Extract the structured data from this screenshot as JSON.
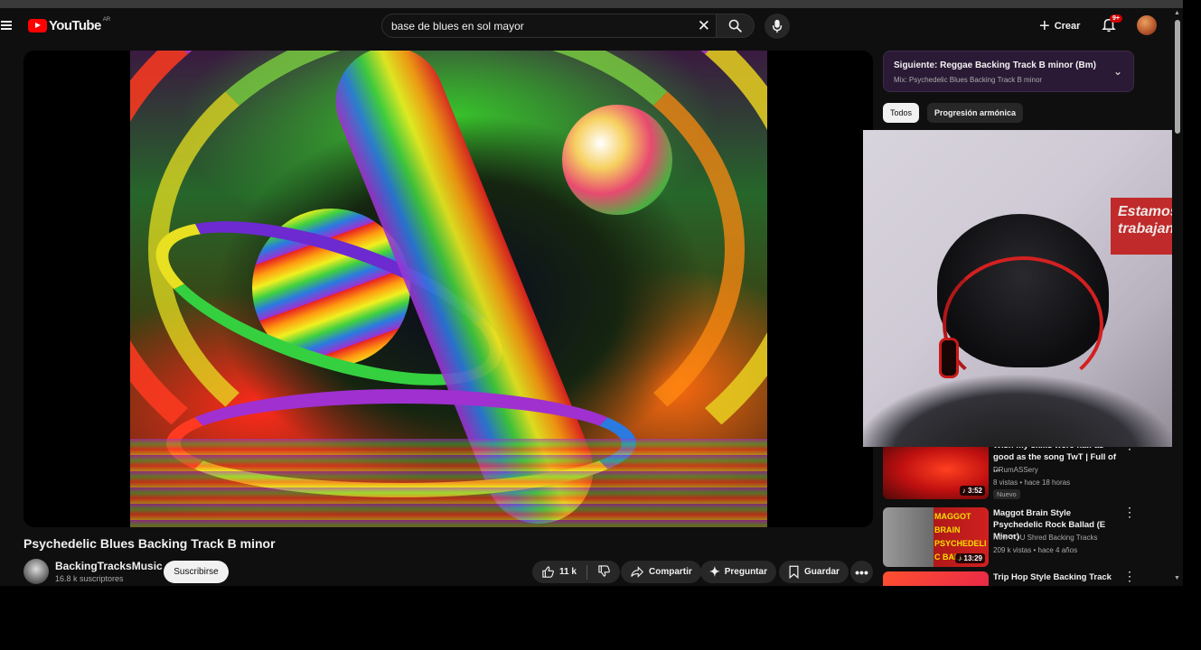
{
  "header": {
    "logo_text": "YouTube",
    "country_code": "AR",
    "search_value": "base de blues en sol mayor",
    "create_label": "Crear",
    "notification_badge": "9+"
  },
  "video": {
    "title": "Psychedelic Blues Backing Track B minor",
    "channel_name": "BackingTracksMusic",
    "subscribers": "16.8 k suscriptores",
    "subscribe_label": "Suscribirse",
    "likes": "11 k",
    "share_label": "Compartir",
    "ask_label": "Preguntar",
    "save_label": "Guardar"
  },
  "up_next": {
    "title": "Siguiente: Reggae Backing Track B minor (Bm)",
    "mix": "Mix: Psychedelic Blues Backing Track B minor"
  },
  "chips": [
    "Todos",
    "Progresión armónica"
  ],
  "webcam": {
    "sign_text": "Estamos trabajando"
  },
  "recommendations": [
    {
      "title": "Wish my skills were half as good as the song TwT | Full of ...",
      "channel": "DRumASSery",
      "meta": "8 vistas • hace 18 horas",
      "badge": "Nuevo",
      "duration": "♪ 3:52"
    },
    {
      "title": "Maggot Brain Style Psychedelic Rock Ballad (E Minor)",
      "channel": "Now YOU Shred Backing Tracks",
      "meta": "209 k vistas • hace 4 años",
      "duration": "♪ 13:29",
      "thumb_text": "MAGGOT BRAIN PSYCHEDELIC BALL"
    },
    {
      "title": "Trip Hop Style Backing Track"
    }
  ],
  "colors": {
    "brand_red": "#ff0000",
    "background": "#0f0f0f",
    "up_next_bg": "#2a1a35"
  }
}
